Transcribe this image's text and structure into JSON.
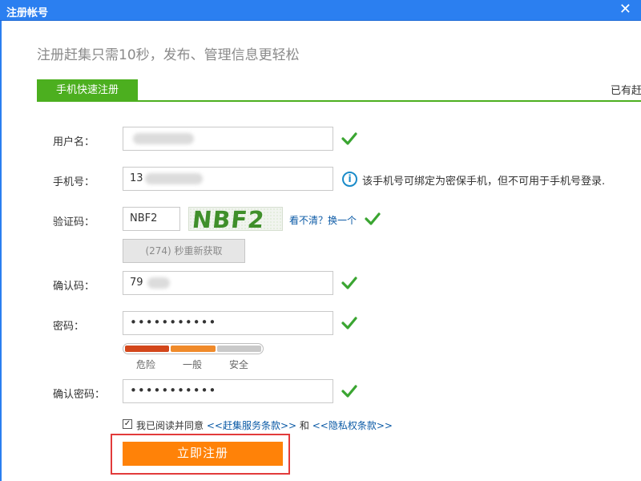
{
  "window": {
    "title": "注册帐号",
    "close_glyph": "✕"
  },
  "subtitle": "注册赶集只需10秒，发布、管理信息更轻松",
  "tabs": [
    {
      "label": "手机快速注册"
    }
  ],
  "login_prompt": "已有赶",
  "fields": {
    "username": {
      "label": "用户名：",
      "value": ""
    },
    "phone": {
      "label": "手机号：",
      "value": "13",
      "hint": "该手机号可绑定为密保手机，但不可用于手机号登录."
    },
    "captcha": {
      "label": "验证码：",
      "value": "NBF2",
      "image_text": "NBF2",
      "refresh_label": "看不清？换一个"
    },
    "resend": {
      "label": "(274) 秒重新获取"
    },
    "confirm_code": {
      "label": "确认码：",
      "value": "79"
    },
    "password": {
      "label": "密码：",
      "value": "•••••••••••"
    },
    "strength": {
      "danger": "危险",
      "mid": "一般",
      "safe": "安全",
      "level": "一般"
    },
    "confirm_password": {
      "label": "确认密码：",
      "value": "•••••••••••"
    }
  },
  "agreement": {
    "checked": true,
    "prefix": "我已阅读并同意",
    "service_link": "<<赶集服务条款>>",
    "conjunction": "和",
    "privacy_link": "<<隐私权条款>>"
  },
  "submit_label": "立即注册",
  "colors": {
    "accent_green": "#4caf1f",
    "title_blue": "#2b7ff0",
    "submit_orange": "#ff8208",
    "check_green": "#3aa531"
  },
  "icons": {
    "valid": "check-icon",
    "hint": "info-icon"
  }
}
